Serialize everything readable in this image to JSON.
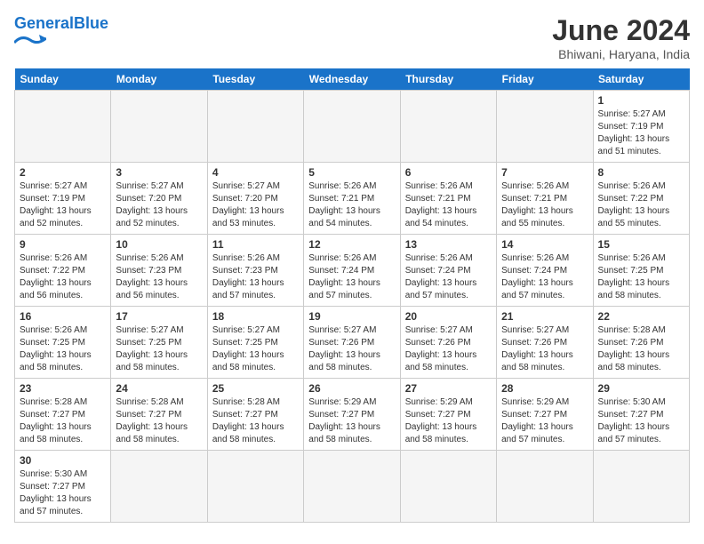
{
  "header": {
    "logo_general": "General",
    "logo_blue": "Blue",
    "month": "June 2024",
    "location": "Bhiwani, Haryana, India"
  },
  "days_of_week": [
    "Sunday",
    "Monday",
    "Tuesday",
    "Wednesday",
    "Thursday",
    "Friday",
    "Saturday"
  ],
  "weeks": [
    [
      {
        "day": null,
        "empty": true
      },
      {
        "day": null,
        "empty": true
      },
      {
        "day": null,
        "empty": true
      },
      {
        "day": null,
        "empty": true
      },
      {
        "day": null,
        "empty": true
      },
      {
        "day": null,
        "empty": true
      },
      {
        "day": 1,
        "sunrise": "5:27 AM",
        "sunset": "7:19 PM",
        "daylight": "13 hours and 51 minutes."
      }
    ],
    [
      {
        "day": 2,
        "sunrise": "5:27 AM",
        "sunset": "7:19 PM",
        "daylight": "13 hours and 52 minutes."
      },
      {
        "day": 3,
        "sunrise": "5:27 AM",
        "sunset": "7:20 PM",
        "daylight": "13 hours and 52 minutes."
      },
      {
        "day": 4,
        "sunrise": "5:27 AM",
        "sunset": "7:20 PM",
        "daylight": "13 hours and 53 minutes."
      },
      {
        "day": 5,
        "sunrise": "5:26 AM",
        "sunset": "7:21 PM",
        "daylight": "13 hours and 54 minutes."
      },
      {
        "day": 6,
        "sunrise": "5:26 AM",
        "sunset": "7:21 PM",
        "daylight": "13 hours and 54 minutes."
      },
      {
        "day": 7,
        "sunrise": "5:26 AM",
        "sunset": "7:21 PM",
        "daylight": "13 hours and 55 minutes."
      },
      {
        "day": 8,
        "sunrise": "5:26 AM",
        "sunset": "7:22 PM",
        "daylight": "13 hours and 55 minutes."
      }
    ],
    [
      {
        "day": 9,
        "sunrise": "5:26 AM",
        "sunset": "7:22 PM",
        "daylight": "13 hours and 56 minutes."
      },
      {
        "day": 10,
        "sunrise": "5:26 AM",
        "sunset": "7:23 PM",
        "daylight": "13 hours and 56 minutes."
      },
      {
        "day": 11,
        "sunrise": "5:26 AM",
        "sunset": "7:23 PM",
        "daylight": "13 hours and 57 minutes."
      },
      {
        "day": 12,
        "sunrise": "5:26 AM",
        "sunset": "7:24 PM",
        "daylight": "13 hours and 57 minutes."
      },
      {
        "day": 13,
        "sunrise": "5:26 AM",
        "sunset": "7:24 PM",
        "daylight": "13 hours and 57 minutes."
      },
      {
        "day": 14,
        "sunrise": "5:26 AM",
        "sunset": "7:24 PM",
        "daylight": "13 hours and 57 minutes."
      },
      {
        "day": 15,
        "sunrise": "5:26 AM",
        "sunset": "7:25 PM",
        "daylight": "13 hours and 58 minutes."
      }
    ],
    [
      {
        "day": 16,
        "sunrise": "5:26 AM",
        "sunset": "7:25 PM",
        "daylight": "13 hours and 58 minutes."
      },
      {
        "day": 17,
        "sunrise": "5:27 AM",
        "sunset": "7:25 PM",
        "daylight": "13 hours and 58 minutes."
      },
      {
        "day": 18,
        "sunrise": "5:27 AM",
        "sunset": "7:25 PM",
        "daylight": "13 hours and 58 minutes."
      },
      {
        "day": 19,
        "sunrise": "5:27 AM",
        "sunset": "7:26 PM",
        "daylight": "13 hours and 58 minutes."
      },
      {
        "day": 20,
        "sunrise": "5:27 AM",
        "sunset": "7:26 PM",
        "daylight": "13 hours and 58 minutes."
      },
      {
        "day": 21,
        "sunrise": "5:27 AM",
        "sunset": "7:26 PM",
        "daylight": "13 hours and 58 minutes."
      },
      {
        "day": 22,
        "sunrise": "5:28 AM",
        "sunset": "7:26 PM",
        "daylight": "13 hours and 58 minutes."
      }
    ],
    [
      {
        "day": 23,
        "sunrise": "5:28 AM",
        "sunset": "7:27 PM",
        "daylight": "13 hours and 58 minutes."
      },
      {
        "day": 24,
        "sunrise": "5:28 AM",
        "sunset": "7:27 PM",
        "daylight": "13 hours and 58 minutes."
      },
      {
        "day": 25,
        "sunrise": "5:28 AM",
        "sunset": "7:27 PM",
        "daylight": "13 hours and 58 minutes."
      },
      {
        "day": 26,
        "sunrise": "5:29 AM",
        "sunset": "7:27 PM",
        "daylight": "13 hours and 58 minutes."
      },
      {
        "day": 27,
        "sunrise": "5:29 AM",
        "sunset": "7:27 PM",
        "daylight": "13 hours and 58 minutes."
      },
      {
        "day": 28,
        "sunrise": "5:29 AM",
        "sunset": "7:27 PM",
        "daylight": "13 hours and 57 minutes."
      },
      {
        "day": 29,
        "sunrise": "5:30 AM",
        "sunset": "7:27 PM",
        "daylight": "13 hours and 57 minutes."
      }
    ],
    [
      {
        "day": 30,
        "sunrise": "5:30 AM",
        "sunset": "7:27 PM",
        "daylight": "13 hours and 57 minutes."
      },
      {
        "day": null,
        "empty": true
      },
      {
        "day": null,
        "empty": true
      },
      {
        "day": null,
        "empty": true
      },
      {
        "day": null,
        "empty": true
      },
      {
        "day": null,
        "empty": true
      },
      {
        "day": null,
        "empty": true
      }
    ]
  ],
  "labels": {
    "sunrise": "Sunrise:",
    "sunset": "Sunset:",
    "daylight": "Daylight:"
  }
}
